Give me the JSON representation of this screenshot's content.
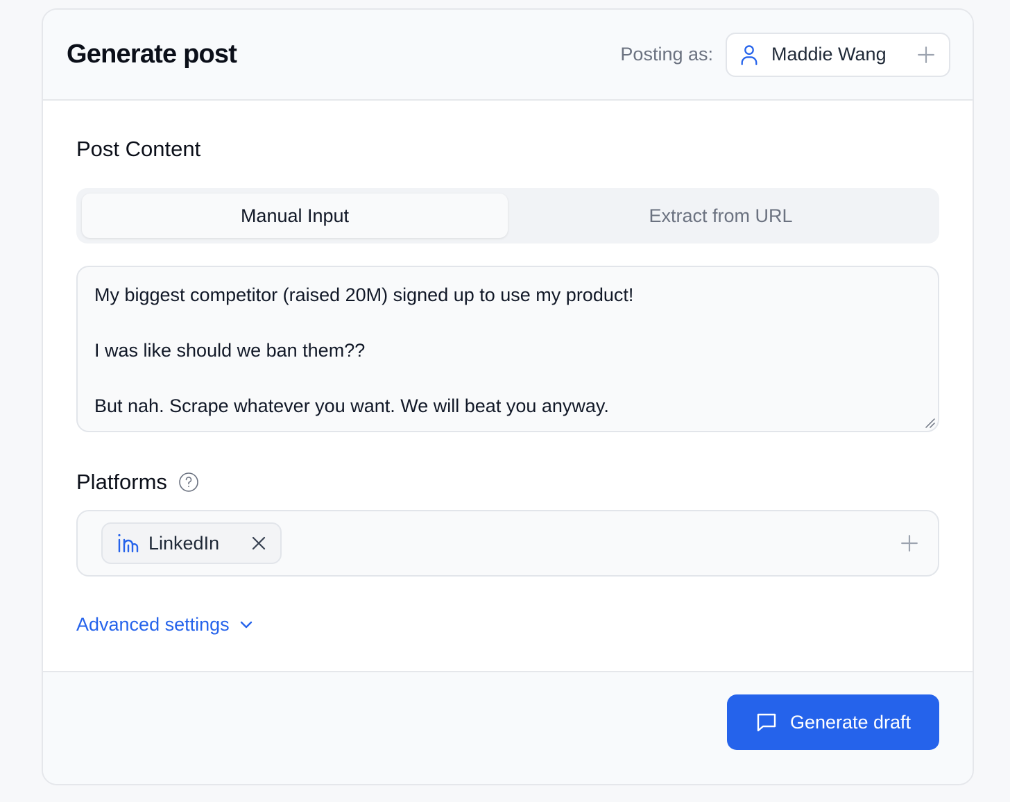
{
  "header": {
    "title": "Generate post",
    "posting_label": "Posting as:",
    "user_name": "Maddie Wang"
  },
  "post_content": {
    "title": "Post Content",
    "tabs": [
      {
        "label": "Manual Input",
        "active": true
      },
      {
        "label": "Extract from URL",
        "active": false
      }
    ],
    "text": "My biggest competitor (raised 20M) signed up to use my product!\n\nI was like should we ban them??\n\nBut nah. Scrape whatever you want. We will beat you anyway."
  },
  "platforms": {
    "title": "Platforms",
    "selected": [
      {
        "label": "LinkedIn",
        "icon": "linkedin-icon"
      }
    ]
  },
  "advanced_settings_label": "Advanced settings",
  "footer": {
    "generate_label": "Generate draft"
  },
  "colors": {
    "accent": "#2563eb",
    "border": "#e2e5ea",
    "muted_text": "#6b7280"
  }
}
